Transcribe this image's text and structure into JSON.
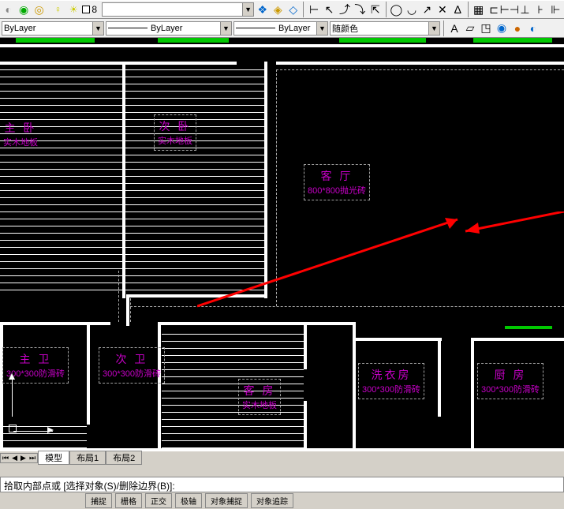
{
  "toolbar": {
    "layer_number": "8",
    "bylayer1": "ByLayer",
    "bylayer2": "ByLayer",
    "bylayer3": "ByLayer",
    "color_select": "随颜色"
  },
  "rooms": {
    "master_bed": {
      "title": "主 卧",
      "sub": "实木地板"
    },
    "second_bed": {
      "title": "次 卧",
      "sub": "实木地板"
    },
    "living": {
      "title": "客 厅",
      "sub": "800*800抛光砖"
    },
    "master_bath": {
      "title": "主 卫",
      "sub": "300*300防滑砖"
    },
    "second_bath": {
      "title": "次 卫",
      "sub": "300*300防滑砖"
    },
    "guest": {
      "title": "客 房",
      "sub": "实木地板"
    },
    "laundry": {
      "title": "洗衣房",
      "sub": "300*300防滑砖"
    },
    "kitchen": {
      "title": "厨 房",
      "sub": "300*300防滑砖"
    }
  },
  "tabs": {
    "model": "模型",
    "layout1": "布局1",
    "layout2": "布局2"
  },
  "command": {
    "prompt": "拾取内部点或 [选择对象(S)/删除边界(B)]:"
  },
  "status": {
    "snap": "捕捉",
    "grid": "栅格",
    "ortho": "正交",
    "polar": "极轴",
    "osnap": "对象捕捉",
    "otrack": "对象追踪"
  }
}
